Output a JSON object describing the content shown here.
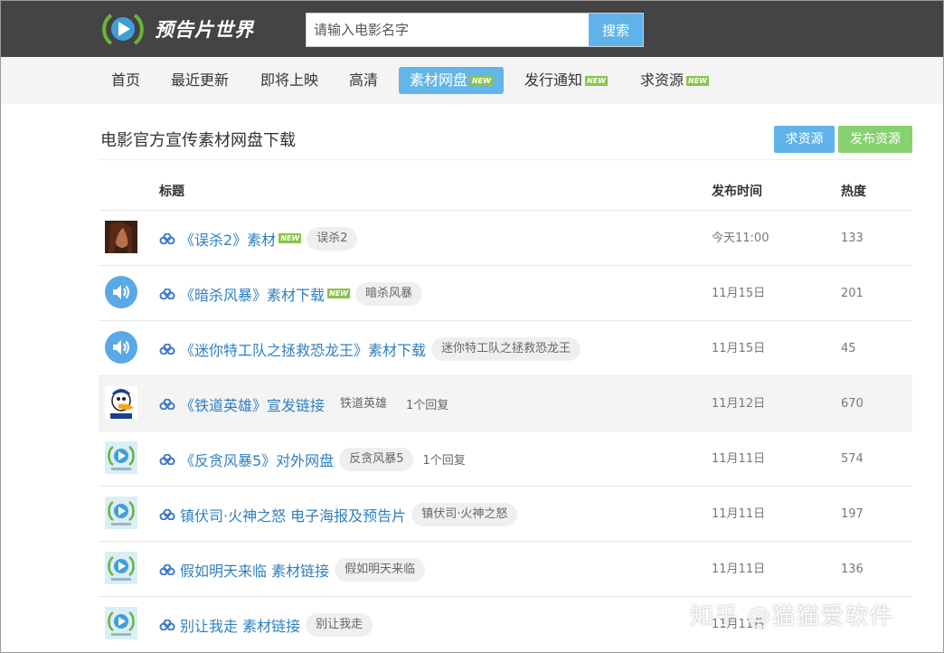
{
  "site": {
    "name": "预告片世界"
  },
  "search": {
    "placeholder": "请输入电影名字",
    "button": "搜索"
  },
  "nav": [
    {
      "label": "首页",
      "new": false
    },
    {
      "label": "最近更新",
      "new": false
    },
    {
      "label": "即将上映",
      "new": false
    },
    {
      "label": "高清",
      "new": false
    },
    {
      "label": "素材网盘",
      "new": true,
      "active": true
    },
    {
      "label": "发行通知",
      "new": true
    },
    {
      "label": "求资源",
      "new": true
    }
  ],
  "new_badge": "NEW",
  "section": {
    "title": "电影官方宣传素材网盘下载",
    "request_button": "求资源",
    "publish_button": "发布资源"
  },
  "table": {
    "headers": {
      "title": "标题",
      "date": "发布时间",
      "heat": "热度"
    },
    "rows": [
      {
        "thumb": "portrait-thumb",
        "title": "《误杀2》素材",
        "new": true,
        "tag": "误杀2",
        "reply": "",
        "date": "今天11:00",
        "heat": "133"
      },
      {
        "thumb": "speaker-icon",
        "title": "《暗杀风暴》素材下载",
        "new": true,
        "tag": "暗杀风暴",
        "reply": "",
        "date": "11月15日",
        "heat": "201"
      },
      {
        "thumb": "speaker-icon",
        "title": "《迷你特工队之拯救恐龙王》素材下载",
        "new": false,
        "tag": "迷你特工队之拯救恐龙王",
        "reply": "",
        "date": "11月15日",
        "heat": "45"
      },
      {
        "thumb": "duck-thumb",
        "title": "《铁道英雄》宣发链接",
        "new": false,
        "tag": "铁道英雄",
        "reply": "1个回复",
        "date": "11月12日",
        "heat": "670",
        "highlight": true
      },
      {
        "thumb": "logo-thumb",
        "title": "《反贪风暴5》对外网盘",
        "new": false,
        "tag": "反贪风暴5",
        "reply": "1个回复",
        "date": "11月11日",
        "heat": "574"
      },
      {
        "thumb": "logo-thumb",
        "title": "镇伏司·火神之怒 电子海报及预告片",
        "new": false,
        "tag": "镇伏司·火神之怒",
        "reply": "",
        "date": "11月11日",
        "heat": "197"
      },
      {
        "thumb": "logo-thumb",
        "title": "假如明天来临 素材链接",
        "new": false,
        "tag": "假如明天来临",
        "reply": "",
        "date": "11月11日",
        "heat": "136"
      },
      {
        "thumb": "logo-thumb",
        "title": "别让我走 素材链接",
        "new": false,
        "tag": "别让我走",
        "reply": "",
        "date": "11月11日",
        "heat": ""
      }
    ]
  },
  "watermark": "知乎 @猫猫爱软件",
  "colors": {
    "header_bg": "#444444",
    "accent_blue": "#5fb3ea",
    "accent_green": "#86d16f",
    "link": "#2f7fc0",
    "new_badge": "#8bc34a"
  }
}
